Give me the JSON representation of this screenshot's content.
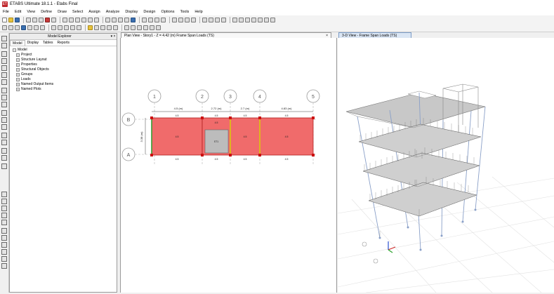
{
  "window": {
    "title": "ETABS Ultimate 18.1.1 - Etabs Final",
    "logo_text": "ET"
  },
  "menu": [
    "File",
    "Edit",
    "View",
    "Define",
    "Draw",
    "Select",
    "Assign",
    "Analyze",
    "Display",
    "Design",
    "Options",
    "Tools",
    "Help"
  ],
  "explorer": {
    "title": "Model Explorer",
    "pin": "▾ ×",
    "tabs": [
      "Model",
      "Display",
      "Tables",
      "Reports"
    ],
    "items": [
      {
        "label": "Model",
        "expander": "−"
      },
      {
        "label": "Project",
        "expander": "+"
      },
      {
        "label": "Structure Layout",
        "expander": "+"
      },
      {
        "label": "Properties",
        "expander": "+"
      },
      {
        "label": "Structural Objects",
        "expander": "+"
      },
      {
        "label": "Groups",
        "expander": "+"
      },
      {
        "label": "Loads",
        "expander": "+"
      },
      {
        "label": "Named Output Items",
        "expander": "+"
      },
      {
        "label": "Named Plots",
        "expander": "+"
      }
    ]
  },
  "plan_view": {
    "tab_label": "Plan View - Story1 - Z = 4.42 (m) Frame Span Loads (TS)",
    "close": "×",
    "grid_x": [
      "1",
      "2",
      "3",
      "4",
      "5"
    ],
    "grid_y": [
      "B",
      "A"
    ],
    "dims": [
      "4.5 (m)",
      "2.72 (m)",
      "2.7 (m)",
      "4.83 (m)"
    ],
    "dim_y": "3.38 (m)",
    "load_tag": "4.5",
    "stair_label": "ST1"
  },
  "view3d": {
    "tab_label": "3-D View - Frame Span Loads (TS)"
  }
}
